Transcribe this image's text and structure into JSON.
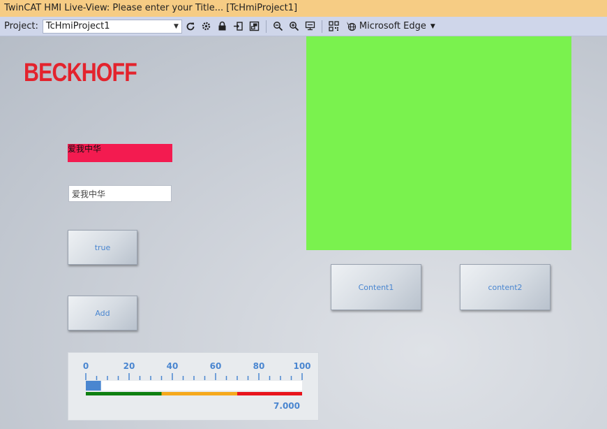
{
  "window": {
    "title": "TwinCAT HMI Live-View: Please enter your Title... [TcHmiProject1]"
  },
  "toolbar": {
    "project_label": "Project:",
    "project_value": "TcHmiProject1",
    "browser_label": "Microsoft Edge",
    "icons": [
      "refresh-icon",
      "settings-gear-icon",
      "lock-icon",
      "export-icon",
      "window-icon",
      "zoom-out-icon",
      "zoom-in-icon",
      "zoom-reset-icon",
      "qr-code-icon",
      "browser-globe-icon"
    ]
  },
  "canvas": {
    "logo_text": "BECKHOFF",
    "textblock_value": "爱我中华",
    "textbox_value": "爱我中华",
    "button_true_label": "true",
    "button_add_label": "Add",
    "button_content1_label": "Content1",
    "button_content2_label": "content2",
    "colors": {
      "logo": "#e3232d",
      "textblock_bg": "#f31b50",
      "green_region": "#7af24e",
      "button_text": "#4a86d0"
    }
  },
  "gauge": {
    "min": 0,
    "max": 100,
    "tick_labels": [
      "0",
      "20",
      "40",
      "60",
      "80",
      "100"
    ],
    "value": 7,
    "value_text": "7.000",
    "zones": [
      {
        "from": 0,
        "to": 35,
        "color": "#0d7f10"
      },
      {
        "from": 35,
        "to": 70,
        "color": "#f5a81c"
      },
      {
        "from": 70,
        "to": 100,
        "color": "#e8141c"
      }
    ],
    "bar_color": "#4a86d0"
  }
}
